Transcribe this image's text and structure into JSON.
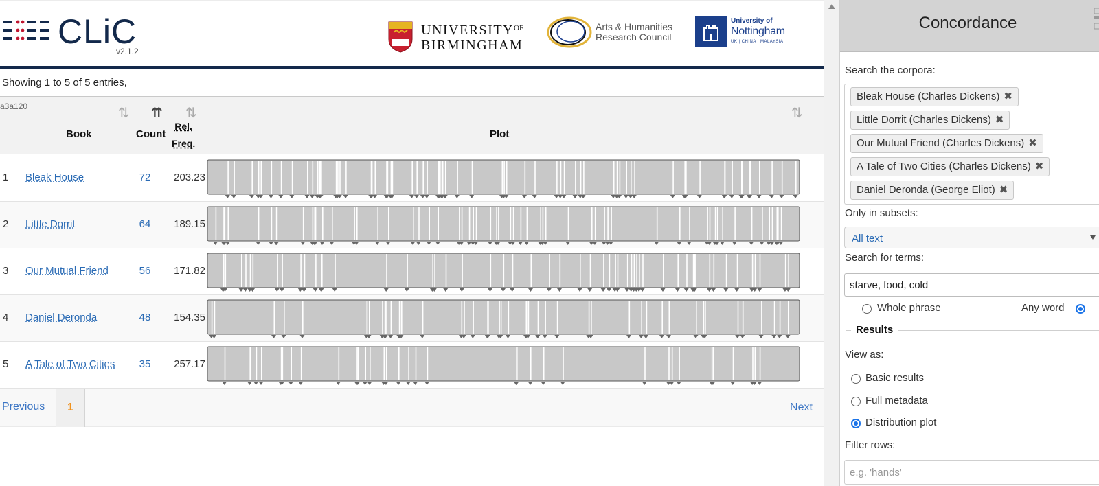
{
  "header": {
    "logo_text": "CLiC",
    "version": "v2.1.2",
    "partners": {
      "birmingham_line1": "UNIVERSITY",
      "birmingham_of": "OF",
      "birmingham_line2": "BIRMINGHAM",
      "ahrc_line1": "Arts & Humanities",
      "ahrc_line2": "Research Council",
      "nottingham_line1": "University of",
      "nottingham_line2": "Nottingham",
      "nottingham_line3": "UK | CHINA | MALAYSIA"
    }
  },
  "table": {
    "info": "Showing 1 to 5 of 5 entries,",
    "table_id": "a3a120",
    "columns": {
      "book": "Book",
      "count": "Count",
      "rel_line1": "Rel.",
      "rel_line2": "Freq.",
      "plot": "Plot"
    },
    "rows": [
      {
        "index": "1",
        "book": "Bleak House",
        "count": "72",
        "rel_freq": "203.23"
      },
      {
        "index": "2",
        "book": "Little Dorrit",
        "count": "64",
        "rel_freq": "189.15"
      },
      {
        "index": "3",
        "book": "Our Mutual Friend",
        "count": "56",
        "rel_freq": "171.82"
      },
      {
        "index": "4",
        "book": "Daniel Deronda",
        "count": "48",
        "rel_freq": "154.35"
      },
      {
        "index": "5",
        "book": "A Tale of Two Cities",
        "count": "35",
        "rel_freq": "257.17"
      }
    ],
    "pagination": {
      "previous": "Previous",
      "current": "1",
      "next": "Next"
    }
  },
  "panel": {
    "title": "Concordance",
    "search_corpora_label": "Search the corpora:",
    "corpora": [
      "Bleak House (Charles Dickens)",
      "Little Dorrit (Charles Dickens)",
      "Our Mutual Friend (Charles Dickens)",
      "A Tale of Two Cities (Charles Dickens)",
      "Daniel Deronda (George Eliot)"
    ],
    "remove_glyph": "✖",
    "subsets_label": "Only in subsets:",
    "subset_value": "All text",
    "terms_label": "Search for terms:",
    "terms_value": "starve, food, cold",
    "match_options": {
      "whole_phrase": "Whole phrase",
      "any_word": "Any word",
      "selected": "any_word"
    },
    "results_legend": "Results",
    "view_as_label": "View as:",
    "view_options": [
      "Basic results",
      "Full metadata",
      "Distribution plot"
    ],
    "view_selected": "Distribution plot",
    "filter_label": "Filter rows:",
    "filter_placeholder": "e.g. 'hands'"
  },
  "colors": {
    "navy": "#13294b",
    "link": "#2a6bb5",
    "current_page": "#f0921e",
    "radio": "#1a73e8",
    "plot_fill": "#c8c8c8"
  }
}
